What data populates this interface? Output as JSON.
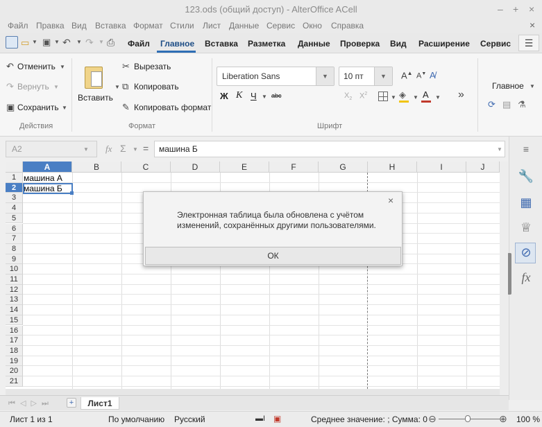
{
  "window": {
    "title": "123.ods (общий доступ) - AlterOffice ACell",
    "buttons": {
      "minimize": "–",
      "maximize": "+",
      "close": "×"
    }
  },
  "menubar": {
    "items": [
      "Файл",
      "Правка",
      "Вид",
      "Вставка",
      "Формат",
      "Стили",
      "Лист",
      "Данные",
      "Сервис",
      "Окно",
      "Справка"
    ],
    "close": "×"
  },
  "tabs": {
    "items": [
      "Файл",
      "Главное",
      "Вставка",
      "Разметка",
      "Данные",
      "Проверка",
      "Вид",
      "Расширение",
      "Сервис"
    ],
    "active": "Главное",
    "menu_icon": "☰"
  },
  "ribbon": {
    "actions": {
      "undo": "Отменить",
      "redo": "Вернуть",
      "save": "Сохранить",
      "group": "Действия"
    },
    "format": {
      "paste": "Вставить",
      "cut": "Вырезать",
      "copy": "Копировать",
      "format_painter": "Копировать формат",
      "group": "Формат"
    },
    "font": {
      "name": "Liberation Sans",
      "size": "10 пт",
      "bold": "Ж",
      "italic": "К",
      "underline": "Ч",
      "strike": "abc",
      "group": "Шрифт",
      "font_color": "#c0392b",
      "highlight_color": "#f1c40f"
    },
    "styles": {
      "label": "Главное"
    }
  },
  "formula": {
    "namebox": "A2",
    "fx": "fx",
    "sum": "Σ",
    "equals": "=",
    "value": "машина Б"
  },
  "grid": {
    "columns": [
      "A",
      "B",
      "C",
      "D",
      "E",
      "F",
      "G",
      "H",
      "I",
      "J"
    ],
    "rows": [
      "1",
      "2",
      "3",
      "4",
      "5",
      "6",
      "7",
      "8",
      "9",
      "10",
      "11",
      "12",
      "13",
      "14",
      "15",
      "16",
      "17",
      "18",
      "19",
      "20",
      "21"
    ],
    "cells": {
      "A1": "машина А",
      "A2": "машина Б"
    },
    "selected_column": "A",
    "selected_row": "2",
    "accent": "#4a7fc4"
  },
  "sheets": {
    "tabs": [
      "Лист1"
    ],
    "add": "+"
  },
  "status": {
    "sheet": "Лист 1 из 1",
    "style": "По умолчанию",
    "language": "Русский",
    "summary": "Среднее значение: ; Сумма: 0",
    "zoom_out": "⊖",
    "zoom_in": "⊕",
    "zoom": "100 %"
  },
  "dialog": {
    "message": "Электронная таблица была обновлена с учётом изменений, сохранённых другими пользователями.",
    "ok": "ОК",
    "close": "×"
  }
}
